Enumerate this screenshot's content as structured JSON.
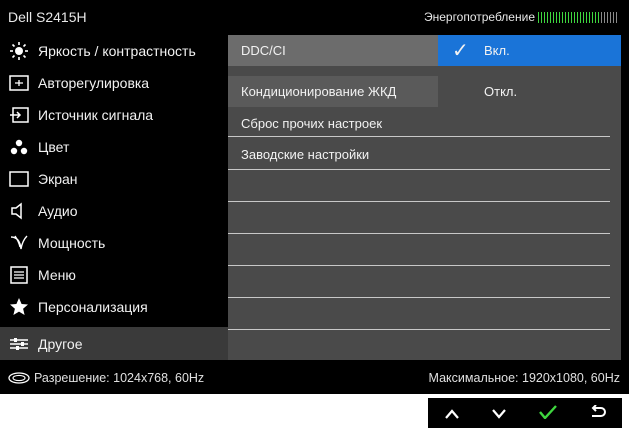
{
  "header": {
    "title": "Dell S2415H",
    "energy_label": "Энергопотребление"
  },
  "menu": [
    {
      "label": "Яркость / контрастность",
      "icon": "brightness-icon"
    },
    {
      "label": "Авторегулировка",
      "icon": "auto-adjust-icon"
    },
    {
      "label": "Источник сигнала",
      "icon": "input-source-icon"
    },
    {
      "label": "Цвет",
      "icon": "color-icon"
    },
    {
      "label": "Экран",
      "icon": "display-icon"
    },
    {
      "label": "Аудио",
      "icon": "audio-icon"
    },
    {
      "label": "Мощность",
      "icon": "power-icon"
    },
    {
      "label": "Меню",
      "icon": "menu-icon"
    },
    {
      "label": "Персонализация",
      "icon": "star-icon"
    },
    {
      "label": "Другое",
      "icon": "other-icon",
      "active": true
    }
  ],
  "submenu": [
    {
      "label": "DDC/CI"
    },
    {
      "label": "Кондиционирование ЖКД"
    },
    {
      "label": "Сброс прочих настроек"
    },
    {
      "label": "Заводские настройки"
    }
  ],
  "options": [
    {
      "label": "Вкл.",
      "selected": true
    },
    {
      "label": "Откл.",
      "selected": false
    }
  ],
  "footer": {
    "resolution": "Разрешение: 1024x768, 60Hz",
    "max": "Максимальное: 1920x1080, 60Hz"
  },
  "nav": {
    "up": "up-icon",
    "down": "down-icon",
    "ok": "check-icon",
    "back": "back-icon"
  },
  "colors": {
    "accent": "#1a74d8",
    "energy_bar": "#3fd63f",
    "panel": "#4a4a4a",
    "active_menu": "#3a3a3a"
  }
}
